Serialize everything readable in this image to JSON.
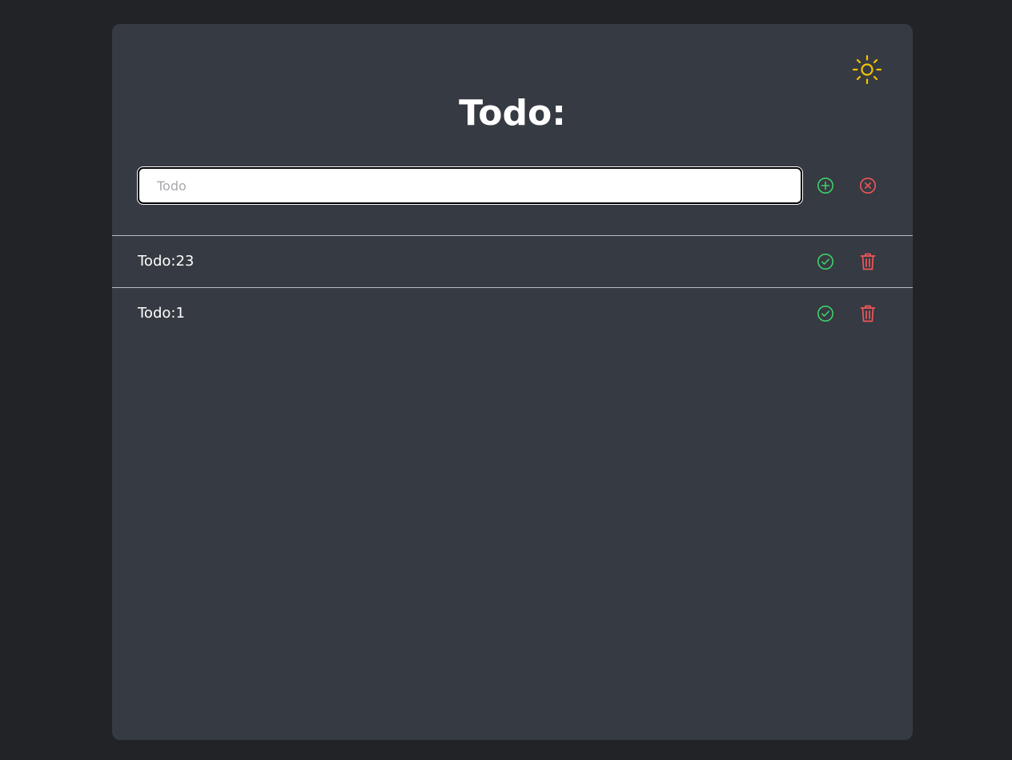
{
  "header": {
    "title": "Todo:",
    "theme_icon": "sun-icon"
  },
  "input": {
    "placeholder": "Todo",
    "value": "",
    "add_icon": "plus-circle-icon",
    "clear_icon": "x-circle-icon"
  },
  "todos": [
    {
      "label": "Todo:23",
      "done_icon": "check-circle-icon",
      "delete_icon": "trash-icon"
    },
    {
      "label": "Todo:1",
      "done_icon": "check-circle-icon",
      "delete_icon": "trash-icon"
    }
  ],
  "colors": {
    "page_bg": "#212327",
    "card_bg": "#363a42",
    "sun": "#f5c400",
    "success": "#3fcf6a",
    "danger": "#f0565a",
    "text": "#ffffff",
    "divider": "#b9bcc2"
  }
}
